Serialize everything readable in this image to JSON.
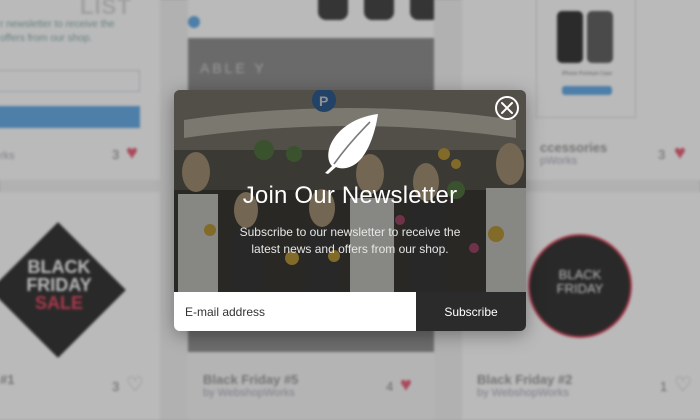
{
  "background": {
    "newsletter_card": {
      "title_fragment": "LIST",
      "text": "r newsletter to receive the\noffers from our shop.",
      "author_fragment": "rks",
      "like_count": "3"
    },
    "product_card_top": {
      "photo_text": "ABLE Y"
    },
    "accessories_card": {
      "phone_caption": "iPhone Premium Case",
      "title_fragment": "ccessories",
      "author_fragment": "pWorks",
      "like_count": "3"
    },
    "black_friday_1": {
      "image_line1": "BLACK",
      "image_line2": "FRIDAY",
      "image_line3": "SALE",
      "title_fragment": "#1",
      "like_count": "3"
    },
    "black_friday_5": {
      "title": "Black Friday #5",
      "author": "by WebshopWorks",
      "like_count": "4"
    },
    "black_friday_2": {
      "image_line1": "BLACK",
      "image_line2": "FRIDAY",
      "title": "Black Friday #2",
      "author": "by WebshopWorks",
      "like_count": "1"
    }
  },
  "modal": {
    "title": "Join Our Newsletter",
    "subtitle": "Subscribe to our newsletter to receive the latest news and offers from our shop.",
    "email_placeholder": "E-mail address",
    "subscribe_label": "Subscribe",
    "icons": {
      "logo": "feather-icon",
      "close": "close-icon"
    }
  },
  "colors": {
    "overlay": "#282828",
    "button": "#2b2b2b",
    "heart": "#e85a72",
    "accent_blue": "#5fa8e6"
  }
}
